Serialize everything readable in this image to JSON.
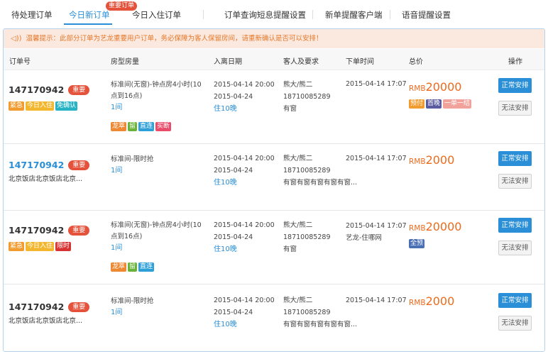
{
  "tabs": [
    {
      "label": "待处理订单"
    },
    {
      "label": "今日新订单",
      "badge": "重要订单"
    },
    {
      "label": "今日入住订单"
    },
    {
      "label": "订单查询短息提醒设置"
    },
    {
      "label": "新单提醒客户端"
    },
    {
      "label": "语音提醒设置"
    }
  ],
  "notice": {
    "text": "温馨提示：此部分订单为艺龙重要用户订单，务必保障为客人保留房间，请重新确认是否可以安排！"
  },
  "columns": [
    "订单号",
    "房型房量",
    "入离日期",
    "客人及要求",
    "下单时间",
    "总价",
    "操作"
  ],
  "rows": [
    {
      "order_no": "147170942",
      "pill": "重要",
      "hotel": "",
      "tags": [
        "紧急",
        "今日入住",
        "免确认"
      ],
      "room_line1": "标准间(无窗)-钟点房4小时(10",
      "room_line2": "点到16点)",
      "room_count": "1间",
      "room_tags": [
        "龙萃",
        "留",
        "直连",
        "买断"
      ],
      "checkin": "2015-04-14 20:00",
      "checkout": "2015-04-24",
      "nights": "住10晚",
      "guest_name": "熊大/熊二",
      "guest_phone": "18710085289",
      "guest_req": "有窗",
      "order_time": "2015-04-14 17:07",
      "price_currency": "RMB",
      "price_amount": "20000",
      "price_tags": [
        "预付",
        "首晚",
        "一单一结"
      ],
      "btn_primary": "正常安排",
      "btn_secondary": "无法安排"
    },
    {
      "order_no": "147170942",
      "pill": "重要",
      "hotel": "北京饭店北京饭店北京...",
      "tags": [],
      "room_line1": "标准间-限时抢",
      "room_line2": "",
      "room_count": "1间",
      "room_tags": [],
      "checkin": "2015-04-14 20:00",
      "checkout": "2015-04-24",
      "nights": "住10晚",
      "guest_name": "熊大/熊二",
      "guest_phone": "18710085289",
      "guest_req": "有窗有窗有窗有窗有窗...",
      "order_time": "2015-04-14 17:07",
      "price_currency": "RMB",
      "price_amount": "2000",
      "price_tags": [],
      "btn_primary": "正常安排",
      "btn_secondary": "无法安排"
    },
    {
      "order_no": "147170942",
      "pill": "重要",
      "hotel": "",
      "tags": [
        "紧急",
        "今日入住",
        "限时"
      ],
      "room_line1": "标准间(无窗)-钟点房4小时(10",
      "room_line2": "点到16点)",
      "room_count": "1间",
      "room_tags": [
        "龙萃",
        "留",
        "直连"
      ],
      "checkin": "2015-04-14 20:00",
      "checkout": "2015-04-24",
      "nights": "住10晚",
      "guest_name": "熊大/熊二",
      "guest_phone": "18710085289",
      "guest_req": "有窗",
      "order_time": "2015-04-14 17:07",
      "order_source": "艺龙-住哪网",
      "price_currency": "RMB",
      "price_amount": "20000",
      "price_tags": [
        "全预"
      ],
      "btn_primary": "正常安排",
      "btn_secondary": "无法安排"
    },
    {
      "order_no": "147170942",
      "pill": "重要",
      "hotel": "北京饭店北京饭店北京...",
      "tags": [],
      "room_line1": "标准间-限时抢",
      "room_line2": "",
      "room_count": "1间",
      "room_tags": [],
      "checkin": "2015-04-14 20:00",
      "checkout": "2015-04-24",
      "nights": "住10晚",
      "guest_name": "熊大/熊二",
      "guest_phone": "18710085289",
      "guest_req": "有窗有窗有窗有窗有窗...",
      "order_time": "2015-04-14 17:07",
      "price_currency": "RMB",
      "price_amount": "2000",
      "price_tags": [],
      "btn_primary": "正常安排",
      "btn_secondary": "无法安排"
    }
  ],
  "colors": {
    "accent": "#2a8fd6",
    "badge": "#e4523b",
    "price": "#ee6a1c",
    "notice_bg": "#fbe9df",
    "notice_text": "#e5782a"
  },
  "icons": {
    "notice": "speaker-icon"
  }
}
